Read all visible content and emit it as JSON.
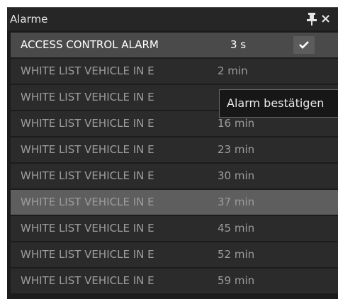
{
  "panel": {
    "title": "Alarme",
    "pin_icon": "pin-icon",
    "close_label": "×"
  },
  "alarms": [
    {
      "name": "ACCESS CONTROL ALARM",
      "time": "3 s",
      "selected": true,
      "ack_icon": "check-icon"
    },
    {
      "name": "WHITE LIST VEHICLE IN E",
      "time": "2 min"
    },
    {
      "name": "WHITE LIST VEHICLE IN E",
      "time": ""
    },
    {
      "name": "WHITE LIST VEHICLE IN E",
      "time": "16 min"
    },
    {
      "name": "WHITE LIST VEHICLE IN E",
      "time": "23 min"
    },
    {
      "name": "WHITE LIST VEHICLE IN E",
      "time": "30 min"
    },
    {
      "name": "WHITE LIST VEHICLE IN E",
      "time": "37 min",
      "highlighted": true
    },
    {
      "name": "WHITE LIST VEHICLE IN E",
      "time": "45 min"
    },
    {
      "name": "WHITE LIST VEHICLE IN E",
      "time": "52 min"
    },
    {
      "name": "WHITE LIST VEHICLE IN E",
      "time": "59 min"
    }
  ],
  "tooltip": {
    "text": "Alarm bestätigen"
  }
}
